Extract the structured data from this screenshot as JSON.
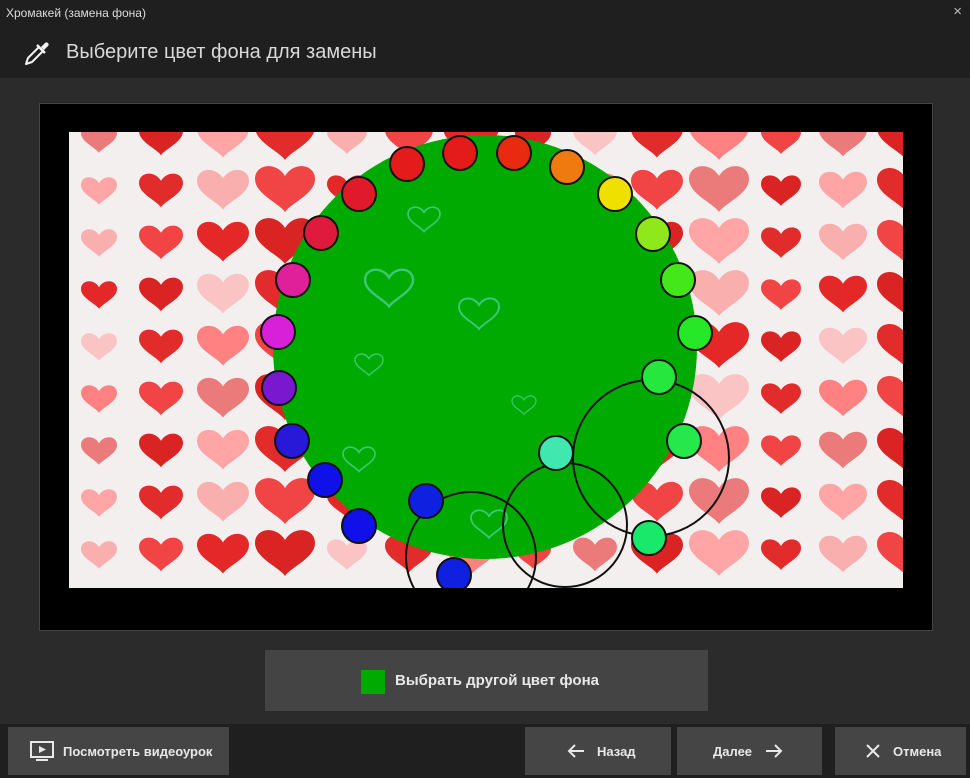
{
  "window": {
    "title": "Хромакей (замена фона)",
    "close_glyph": "×"
  },
  "header": {
    "icon": "eyedropper-icon",
    "heading": "Выберите цвет фона для замены"
  },
  "colors": {
    "chroma_key": "#00aa00",
    "button_bg": "#454545",
    "panel_bg": "#2b2b2b"
  },
  "alt_color_button": {
    "label": "Выбрать другой цвет фона",
    "swatch_color": "#00aa00"
  },
  "footer": {
    "video_button": {
      "label": "Посмотреть видеоурок",
      "icon": "play-video-icon"
    },
    "back_button": {
      "label": "Назад",
      "icon": "arrow-left-icon"
    },
    "next_button": {
      "label": "Далее",
      "icon": "arrow-right-icon"
    },
    "cancel_button": {
      "label": "Отмена",
      "icon": "close-x-icon"
    }
  }
}
